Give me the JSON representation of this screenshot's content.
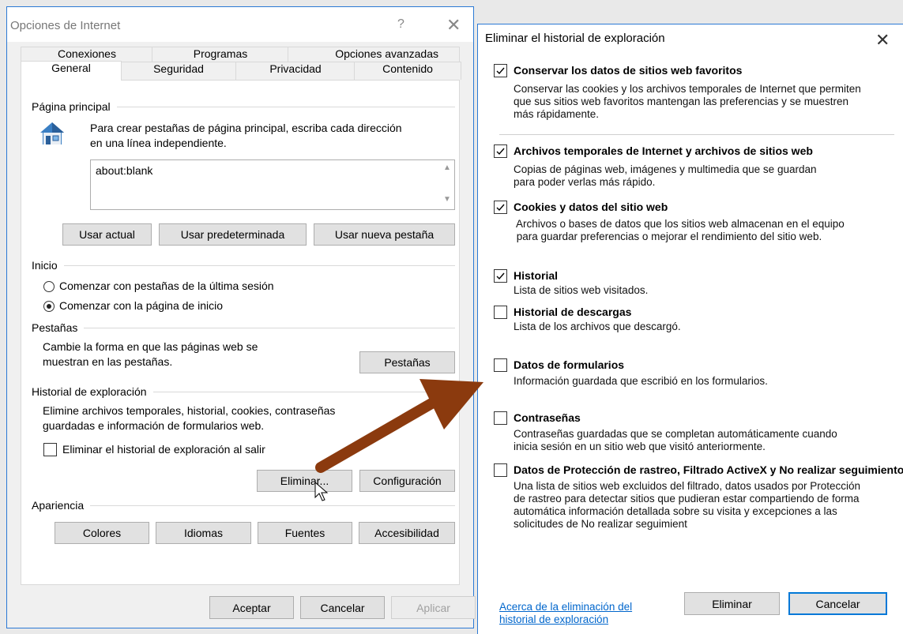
{
  "internet_options": {
    "title": "Opciones de Internet",
    "help_glyph": "?",
    "close_glyph": "✕",
    "tabs_row1": [
      "Conexiones",
      "Programas",
      "Opciones avanzadas"
    ],
    "tabs_row2": [
      "General",
      "Seguridad",
      "Privacidad",
      "Contenido"
    ],
    "selected_tab": "General",
    "homepage": {
      "section": "Página principal",
      "instructions_line1": "Para crear pestañas de página principal, escriba cada dirección",
      "instructions_line2": "en una línea independiente.",
      "value": "about:blank",
      "buttons": [
        "Usar actual",
        "Usar predeterminada",
        "Usar nueva pestaña"
      ]
    },
    "startup": {
      "section": "Inicio",
      "options": [
        "Comenzar con pestañas de la última sesión",
        "Comenzar con la página de inicio"
      ],
      "selected_index": 1
    },
    "tabs_section": {
      "section": "Pestañas",
      "text_line1": "Cambie la forma en que las páginas web se",
      "text_line2": "muestran en las pestañas.",
      "button": "Pestañas"
    },
    "history": {
      "section": "Historial de exploración",
      "text_line1": "Elimine archivos temporales, historial, cookies, contraseñas",
      "text_line2": "guardadas e información de formularios web.",
      "delete_on_exit_label": "Eliminar el historial de exploración al salir",
      "delete_on_exit_checked": false,
      "delete_button": "Eliminar...",
      "settings_button": "Configuración"
    },
    "appearance": {
      "section": "Apariencia",
      "buttons": [
        "Colores",
        "Idiomas",
        "Fuentes",
        "Accesibilidad"
      ]
    },
    "footer": {
      "ok": "Aceptar",
      "cancel": "Cancelar",
      "apply": "Aplicar"
    }
  },
  "delete_history": {
    "title": "Eliminar el historial de exploración",
    "close_glyph": "✕",
    "items": [
      {
        "title": "Conservar los datos de sitios web favoritos",
        "checked": true,
        "desc": "Conservar las cookies y los archivos temporales de Internet que permiten\nque sus sitios web favoritos mantengan las preferencias y se muestren\nmás rápidamente."
      },
      {
        "title": "Archivos temporales de Internet y archivos de sitios web",
        "checked": true,
        "desc": "Copias de páginas web, imágenes y multimedia que se guardan\npara poder verlas más rápido."
      },
      {
        "title": "Cookies y datos del sitio web",
        "checked": true,
        "desc": " Archivos o bases de datos que los sitios web almacenan en el equipo\n para guardar preferencias o mejorar el rendimiento del sitio web."
      },
      {
        "title": "Historial",
        "checked": true,
        "desc": "Lista de sitios web visitados."
      },
      {
        "title": "Historial de descargas",
        "checked": false,
        "desc": "Lista de los archivos que descargó."
      },
      {
        "title": "Datos de formularios",
        "checked": false,
        "desc": "Información guardada que escribió en los formularios."
      },
      {
        "title": "Contraseñas",
        "checked": false,
        "desc": "Contraseñas guardadas que se completan automáticamente cuando\ninicia sesión en un sitio web que visitó anteriormente."
      },
      {
        "title": "Datos de Protección de rastreo, Filtrado ActiveX y No realizar seguimiento",
        "checked": false,
        "desc": "Una lista de sitios web excluidos del filtrado, datos usados por Protección\nde rastreo para detectar sitios que pudieran estar compartiendo de forma\nautomática información detallada sobre su visita y excepciones a las\nsolicitudes de No realizar seguimient"
      }
    ],
    "about_link": "Acerca de la eliminación del\nhistorial de exploración",
    "delete_button": "Eliminar",
    "cancel_button": "Cancelar"
  },
  "colors": {
    "dialog_border": "#2b79d5",
    "link": "#0066cc",
    "arrow": "#8b3a0e"
  }
}
